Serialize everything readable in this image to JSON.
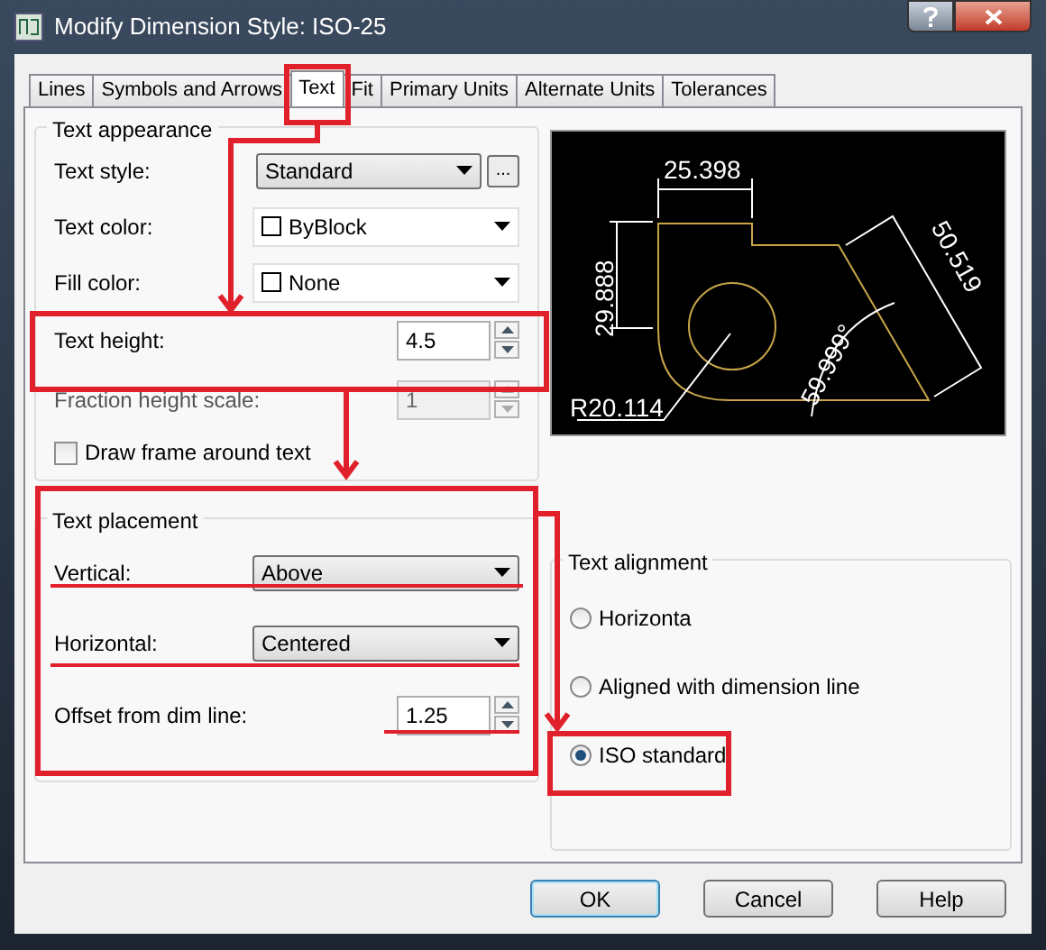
{
  "window": {
    "title": "Modify Dimension Style: ISO-25"
  },
  "tabs": [
    {
      "label": "Lines",
      "selected": false
    },
    {
      "label": "Symbols and Arrows",
      "selected": false
    },
    {
      "label": "Text",
      "selected": true
    },
    {
      "label": "Fit",
      "selected": false
    },
    {
      "label": "Primary Units",
      "selected": false
    },
    {
      "label": "Alternate Units",
      "selected": false
    },
    {
      "label": "Tolerances",
      "selected": false
    }
  ],
  "text_appearance": {
    "title": "Text appearance",
    "rows": [
      {
        "kind": "combo",
        "label": "Text style:",
        "value": "Standard",
        "button": "..."
      },
      {
        "kind": "color",
        "label": "Text color:",
        "value": "ByBlock"
      },
      {
        "kind": "color",
        "label": "Fill color:",
        "value": "None"
      },
      {
        "kind": "spin",
        "label": "Text height:",
        "value": "4.5",
        "disabled": false
      },
      {
        "kind": "spin",
        "label": "Fraction height scale:",
        "value": "1",
        "disabled": true
      },
      {
        "kind": "check",
        "label": "Draw frame around text",
        "checked": false
      }
    ]
  },
  "text_placement": {
    "title": "Text placement",
    "rows": [
      {
        "kind": "combo",
        "label": "Vertical:",
        "value": "Above"
      },
      {
        "kind": "combo",
        "label": "Horizontal:",
        "value": "Centered"
      },
      {
        "kind": "spin",
        "label": "Offset from dim line:",
        "value": "1.25",
        "disabled": false
      }
    ]
  },
  "preview": {
    "labels": [
      "25.398",
      "29.888",
      "R20.114",
      "59.999°",
      "50.519"
    ]
  },
  "text_alignment": {
    "title": "Text alignment",
    "options": [
      {
        "label": "Horizonta",
        "selected": false
      },
      {
        "label": "Aligned with dimension line",
        "selected": false
      },
      {
        "label": "ISO standard",
        "selected": true
      }
    ]
  },
  "buttons": [
    {
      "label": "OK",
      "default": true
    },
    {
      "label": "Cancel",
      "default": false
    },
    {
      "label": "Help",
      "default": false
    }
  ]
}
